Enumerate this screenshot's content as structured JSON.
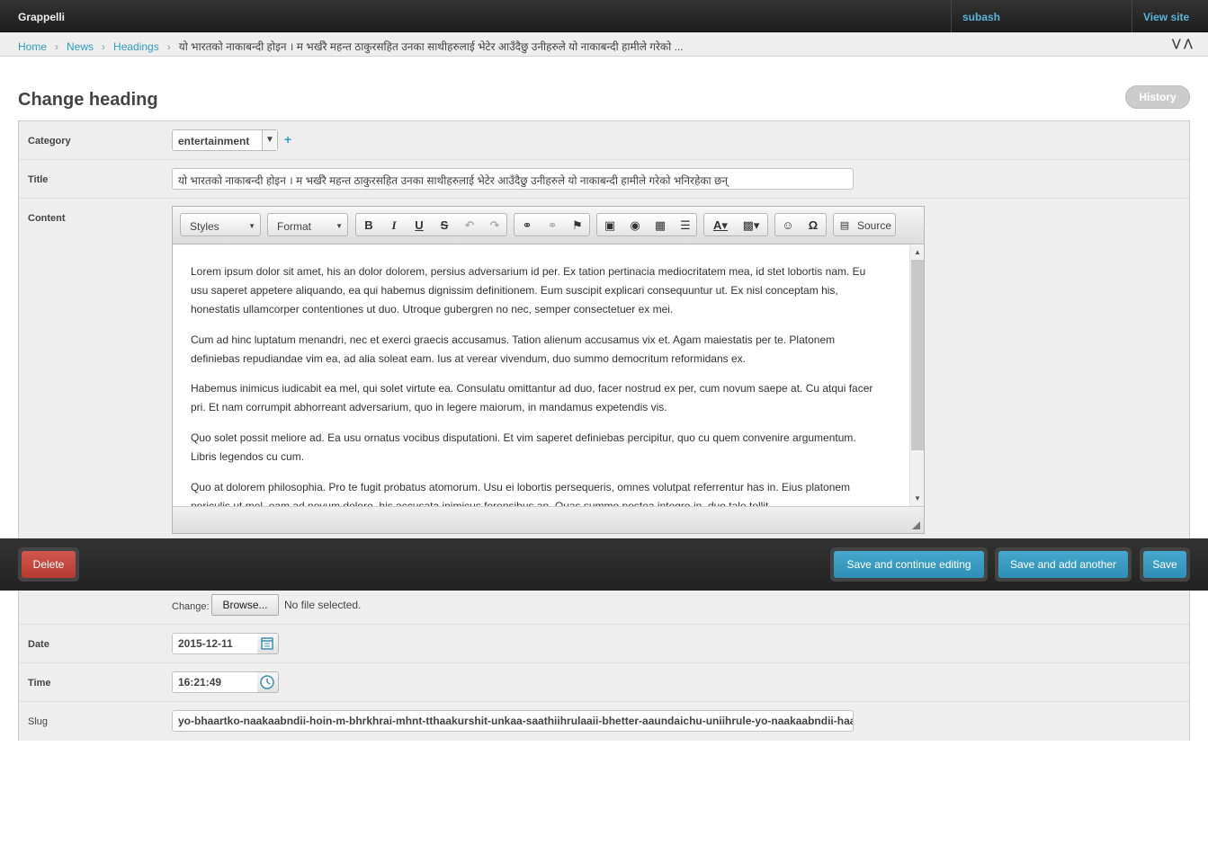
{
  "header": {
    "brand": "Grappelli",
    "user": "subash",
    "view_site": "View site"
  },
  "breadcrumbs": {
    "home": "Home",
    "news": "News",
    "headings": "Headings",
    "current": "यो भारतको नाकाबन्दी होइन । म भर्खरै महन्त ठाकुरसहित उनका साथीहरुलाई भेटेर आउँदैछु उनीहरुले यो नाकाबन्दी हामीले गरेको ..."
  },
  "page": {
    "title": "Change heading",
    "history": "History"
  },
  "form": {
    "category": {
      "label": "Category",
      "value": "entertainment"
    },
    "title": {
      "label": "Title",
      "value": "यो भारतको नाकाबन्दी होइन । म भर्खरै महन्त ठाकुरसहित उनका साथीहरुलाई भेटेर आउँदैछु उनीहरुले यो नाकाबन्दी हामीले गरेको भनिरहेका छन्"
    },
    "content": {
      "label": "Content",
      "toolbar": {
        "styles": "Styles",
        "format": "Format",
        "source": "Source"
      },
      "paragraphs": [
        "Lorem ipsum dolor sit amet, his an dolor dolorem, persius adversarium id per. Ex tation pertinacia mediocritatem mea, id stet lobortis nam. Eu usu saperet appetere aliquando, ea qui habemus dignissim definitionem. Eum suscipit explicari consequuntur ut. Ex nisl conceptam his, honestatis ullamcorper contentiones ut duo. Utroque gubergren no nec, semper consectetuer ex mei.",
        "Cum ad hinc luptatum menandri, nec et exerci graecis accusamus. Tation alienum accusamus vix et. Agam maiestatis per te. Platonem definiebas repudiandae vim ea, ad alia soleat eam. Ius at verear vivendum, duo summo democritum reformidans ex.",
        "Habemus inimicus iudicabit ea mel, qui solet virtute ea. Consulatu omittantur ad duo, facer nostrud ex per, cum novum saepe at. Cu atqui facer pri. Et nam corrumpit abhorreant adversarium, quo in legere maiorum, in mandamus expetendis vis.",
        "Quo solet possit meliore ad. Ea usu ornatus vocibus disputationi. Et vim saperet definiebas percipitur, quo cu quem convenire argumentum. Libris legendos cu cum.",
        "Quo at dolorem philosophia. Pro te fugit probatus atomorum. Usu ei lobortis persequeris, omnes volutpat referrentur has in. Eius platonem periculis ut mel, eam ad novum dolore, his accusata inimicus forensibus an. Quas summo postea integre in, duo tale tollit"
      ]
    },
    "image": {
      "change_label": "Change:",
      "browse": "Browse...",
      "no_file": "No file selected."
    },
    "date": {
      "label": "Date",
      "value": "2015-12-11"
    },
    "time": {
      "label": "Time",
      "value": "16:21:49"
    },
    "slug": {
      "label": "Slug",
      "value": "yo-bhaartko-naakaabndii-hoin-m-bhrkhrai-mhnt-tthaakurshit-unkaa-saathiihrulaaii-bhetter-aaundaichu-uniihrule-yo-naakaabndii-haa"
    }
  },
  "submit": {
    "delete": "Delete",
    "save_continue": "Save and continue editing",
    "save_add": "Save and add another",
    "save": "Save"
  }
}
